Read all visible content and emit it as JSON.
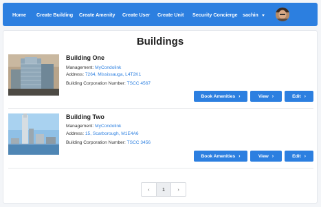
{
  "nav": {
    "items": [
      {
        "label": "Home"
      },
      {
        "label": "Create Building"
      },
      {
        "label": "Create Amenity"
      },
      {
        "label": "Create User"
      },
      {
        "label": "Create Unit"
      },
      {
        "label": "Security Concierge"
      }
    ],
    "user": {
      "name": "sachin"
    }
  },
  "page": {
    "title": "Buildings"
  },
  "buildings": [
    {
      "name": "Building One",
      "management_label": "Management:",
      "management": "MyCondolink",
      "address_label": "Address:",
      "address": "7264, Mississauga, L4T2K1",
      "corp_label": "Building Corporation Number:",
      "corp": "TSCC 4567",
      "buttons": {
        "amenities": "Book Amenities",
        "view": "View",
        "edit": "Edit"
      }
    },
    {
      "name": "Building Two",
      "management_label": "Management:",
      "management": "MyCondolink",
      "address_label": "Address:",
      "address": "15, Scarborough, M1E4A6",
      "corp_label": "Building Corporation Number:",
      "corp": "TSCC 3456",
      "buttons": {
        "amenities": "Book Amenities",
        "view": "View",
        "edit": "Edit"
      }
    }
  ],
  "pagination": {
    "prev": "‹",
    "current": "1",
    "next": "›"
  },
  "colors": {
    "primary": "#2c7fe0",
    "background": "#f3f5f8"
  }
}
